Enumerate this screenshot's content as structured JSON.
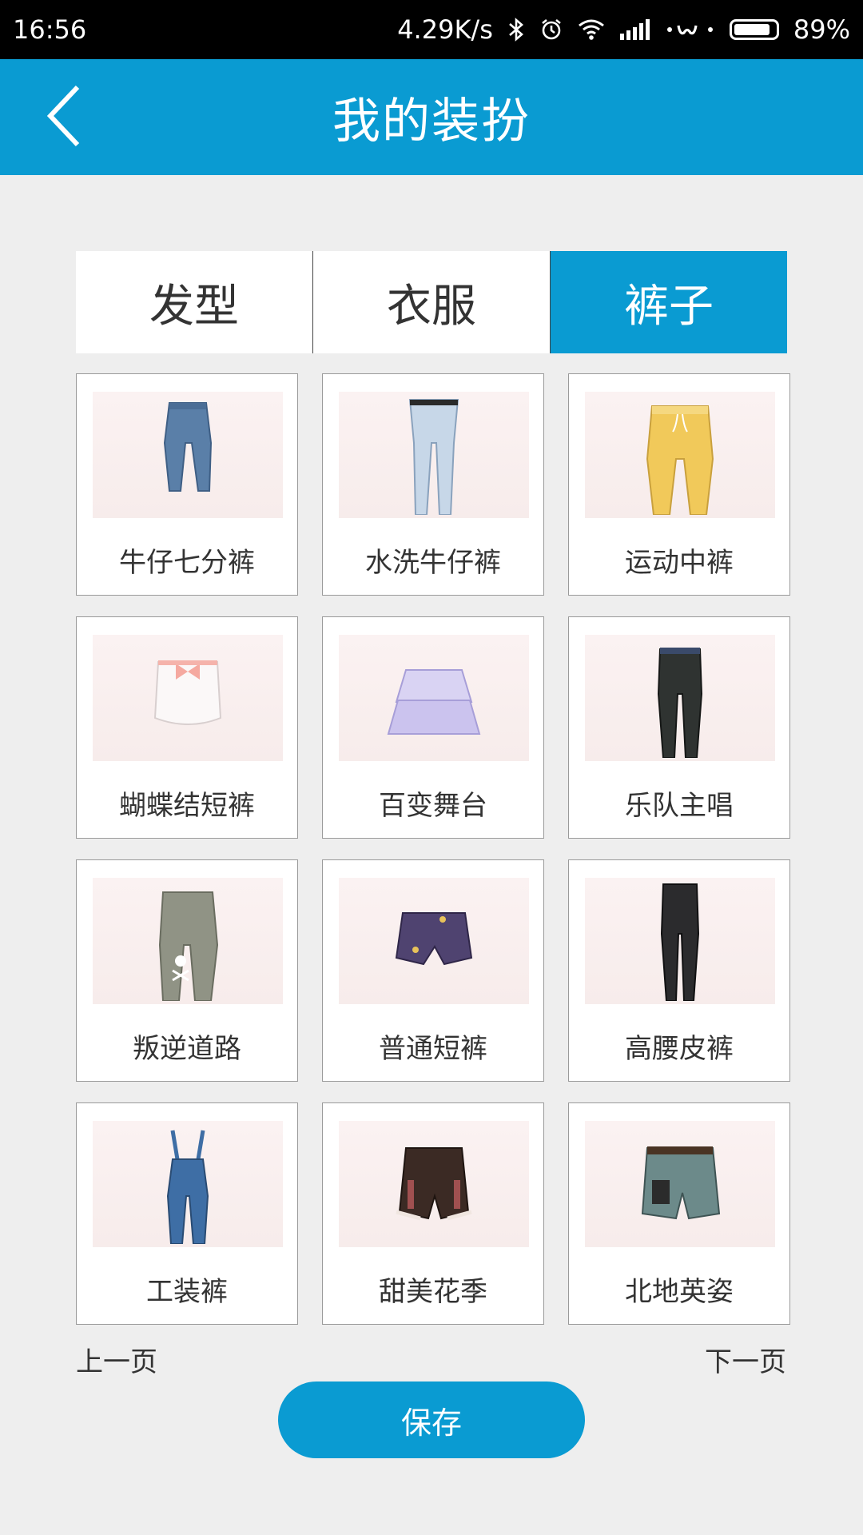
{
  "status": {
    "time": "16:56",
    "speed": "4.29K/s",
    "battery": "89%",
    "battery_level": 0.89
  },
  "header": {
    "title": "我的装扮"
  },
  "tabs": [
    {
      "label": "发型",
      "active": false
    },
    {
      "label": "衣服",
      "active": false
    },
    {
      "label": "裤子",
      "active": true
    }
  ],
  "items": [
    {
      "label": "牛仔七分裤",
      "icon": "cropped-jeans",
      "color": "#5a7fa8"
    },
    {
      "label": "水洗牛仔裤",
      "icon": "washed-jeans",
      "color": "#b9cde0"
    },
    {
      "label": "运动中裤",
      "icon": "sport-pants",
      "color": "#f0c85a"
    },
    {
      "label": "蝴蝶结短裤",
      "icon": "bow-shorts",
      "color": "#f4eeee"
    },
    {
      "label": "百变舞台",
      "icon": "tutu-skirt",
      "color": "#c9c2ea"
    },
    {
      "label": "乐队主唱",
      "icon": "black-pants",
      "color": "#2b2e2e"
    },
    {
      "label": "叛逆道路",
      "icon": "skull-cargo",
      "color": "#8f9285"
    },
    {
      "label": "普通短裤",
      "icon": "purple-shorts",
      "color": "#4f4370"
    },
    {
      "label": "高腰皮裤",
      "icon": "leather-pants",
      "color": "#2a2a2c"
    },
    {
      "label": "工装裤",
      "icon": "overalls",
      "color": "#3e6ea5"
    },
    {
      "label": "甜美花季",
      "icon": "bloomers",
      "color": "#3b2a24"
    },
    {
      "label": "北地英姿",
      "icon": "camo-shorts",
      "color": "#6c8a8a"
    }
  ],
  "pager": {
    "prev": "上一页",
    "next": "下一页"
  },
  "actions": {
    "save": "保存"
  },
  "colors": {
    "accent": "#0a9bd2",
    "background": "#eeeeee"
  }
}
